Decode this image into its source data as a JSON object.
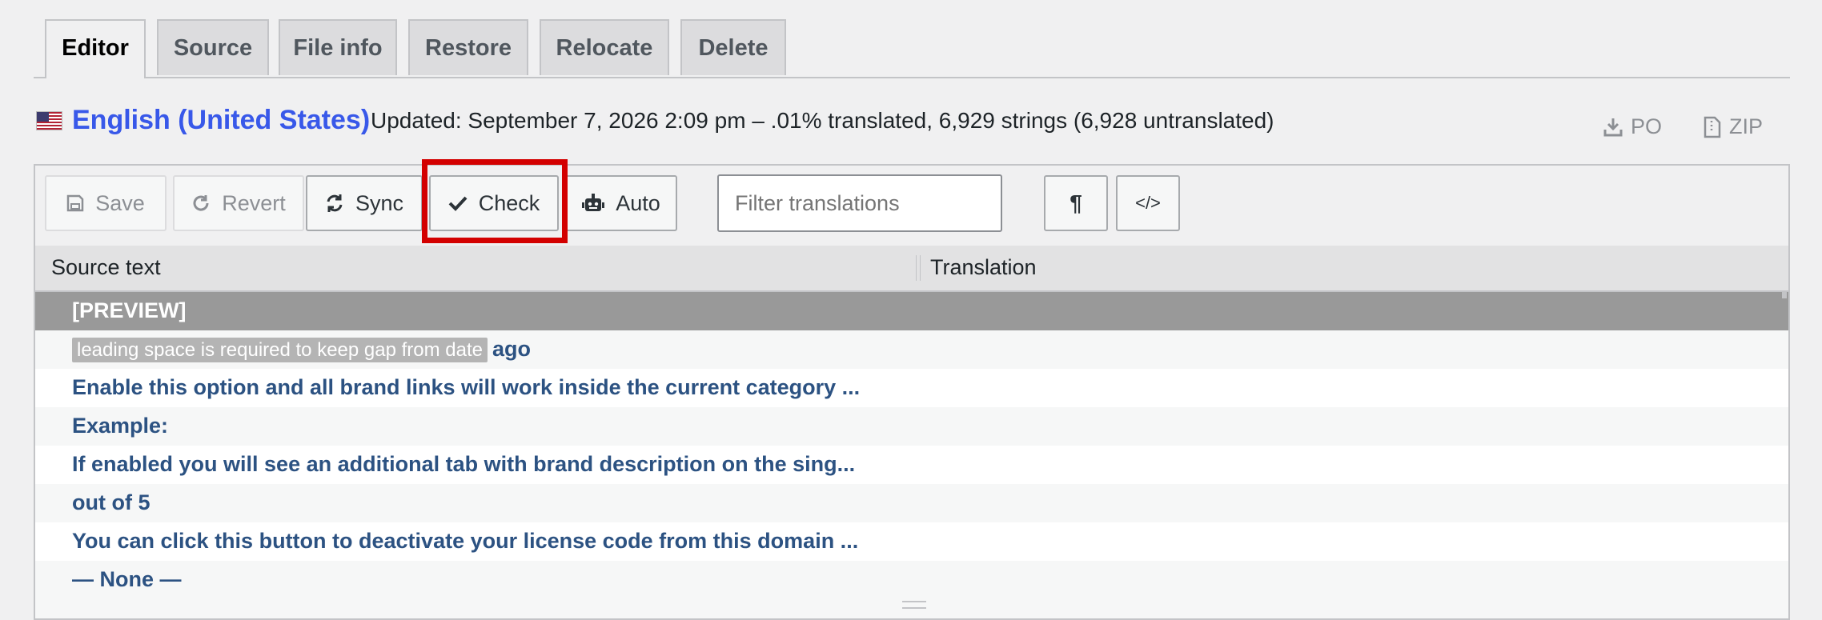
{
  "tabs": [
    {
      "label": "Editor",
      "active": true
    },
    {
      "label": "Source",
      "active": false
    },
    {
      "label": "File info",
      "active": false
    },
    {
      "label": "Restore",
      "active": false
    },
    {
      "label": "Relocate",
      "active": false
    },
    {
      "label": "Delete",
      "active": false
    }
  ],
  "header": {
    "language": "English (United States)",
    "status": "Updated: September 7, 2026 2:09 pm – .01% translated, 6,929 strings (6,928 untranslated)",
    "download_po": "PO",
    "download_zip": "ZIP"
  },
  "toolbar": {
    "save_label": "Save",
    "revert_label": "Revert",
    "sync_label": "Sync",
    "check_label": "Check",
    "auto_label": "Auto",
    "filter_placeholder": "Filter translations",
    "pilcrow_symbol": "¶",
    "code_symbol": "</>"
  },
  "table": {
    "col_source": "Source text",
    "col_translation": "Translation",
    "rows": [
      {
        "context": "",
        "text": "[PREVIEW]",
        "selected": true
      },
      {
        "context": "leading space is required to keep gap from date",
        "text": "ago",
        "selected": false
      },
      {
        "context": "",
        "text": "Enable this option and all brand links will work inside the current category ...",
        "selected": false
      },
      {
        "context": "",
        "text": "Example:",
        "selected": false
      },
      {
        "context": "",
        "text": "If enabled you will see an additional tab with brand description on the sing...",
        "selected": false
      },
      {
        "context": "",
        "text": "out of 5",
        "selected": false
      },
      {
        "context": "",
        "text": "You can click this button to deactivate your license code from this domain ...",
        "selected": false
      },
      {
        "context": "",
        "text": "— None —",
        "selected": false
      }
    ]
  },
  "colors": {
    "language_link": "#3858e9",
    "row_text": "#2c5282",
    "selected_row": "#999999",
    "highlight_box": "#d30000"
  },
  "icons": {
    "save": "floppy-disk-icon",
    "revert": "undo-icon",
    "sync": "refresh-icon",
    "check": "checkmark-icon",
    "auto": "robot-icon",
    "po": "download-icon",
    "zip": "file-zip-icon",
    "flag": "us-flag-icon"
  }
}
